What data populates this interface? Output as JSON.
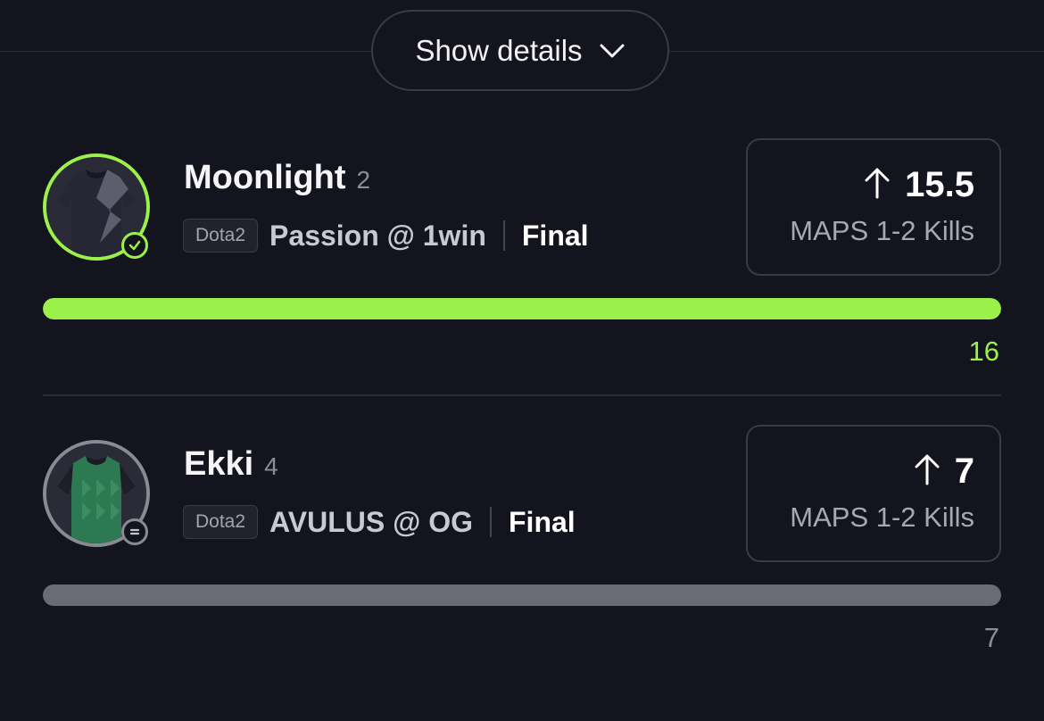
{
  "details_button": {
    "label": "Show details",
    "icon": "chevron-down-icon"
  },
  "picks": [
    {
      "name": "Moonlight",
      "count": "2",
      "game": "Dota2",
      "match": "Passion @ 1win",
      "status": "Final",
      "direction": "up-arrow-icon",
      "line": "15.5",
      "stat": "MAPS 1-2 Kills",
      "actual": "16",
      "progress_pct": 100,
      "result_icon": "check-icon",
      "color": "#9cf04a",
      "jersey_color": "#262635"
    },
    {
      "name": "Ekki",
      "count": "4",
      "game": "Dota2",
      "match": "AVULUS @ OG",
      "status": "Final",
      "direction": "up-arrow-icon",
      "line": "7",
      "stat": "MAPS 1-2 Kills",
      "actual": "7",
      "progress_pct": 100,
      "result_icon": "equals-icon",
      "color": "#6b6b75",
      "jersey_color": "#2d7a52"
    }
  ],
  "colors": {
    "background": "#14141f",
    "win": "#9cf04a",
    "push": "#6b6b75"
  }
}
